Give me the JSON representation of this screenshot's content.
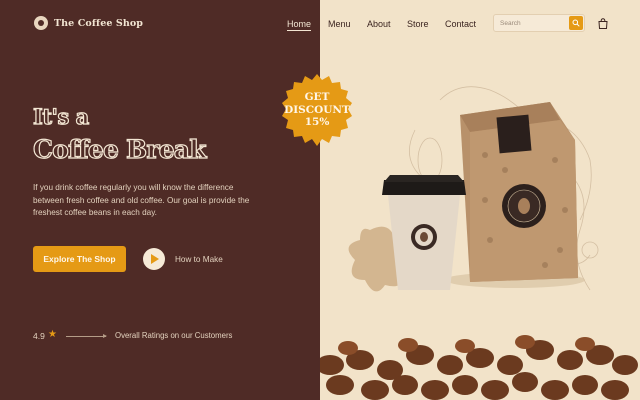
{
  "header": {
    "logo_text": "The Coffee Shop",
    "nav": [
      "Home",
      "Menu",
      "About",
      "Store",
      "Contact"
    ],
    "active_nav": "Home",
    "search_placeholder": "Search"
  },
  "hero": {
    "title_line1": "It's a",
    "title_line2": "Coffee Break",
    "description": "If you drink coffee regularly you will know the difference between fresh coffee and old coffee. Our goal is provide the freshest coffee beans in each day.",
    "primary_button": "Explore The Shop",
    "secondary_link": "How to Make"
  },
  "rating": {
    "value": "4.9",
    "label": "Overall Ratings on our Customers"
  },
  "badge": {
    "line1": "GET",
    "line2": "DISCOUNT",
    "line3": "15%"
  },
  "colors": {
    "dark_brown": "#4f2b26",
    "cream": "#f2e3c9",
    "accent": "#e59a15"
  },
  "icons": [
    "logo-icon",
    "search-icon",
    "cart-icon",
    "play-icon",
    "star-icon",
    "arrow-icon"
  ]
}
